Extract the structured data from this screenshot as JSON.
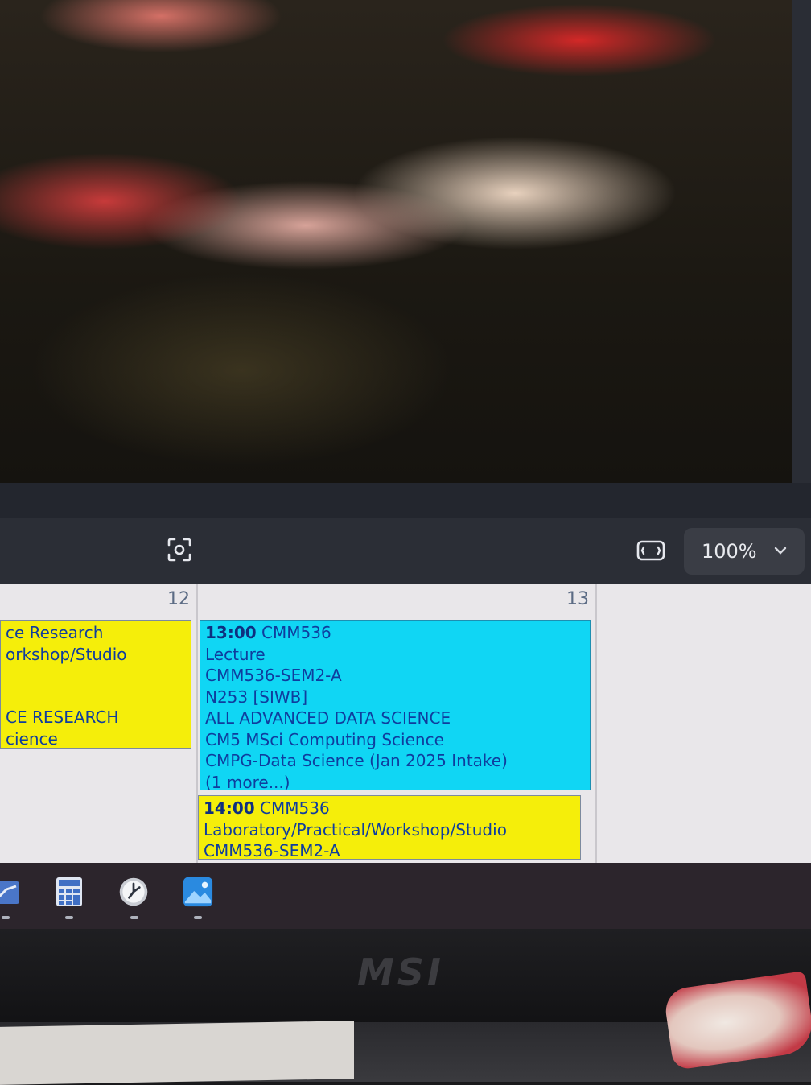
{
  "viewer": {
    "zoom_value": "100%",
    "icons": [
      "focus-frame-icon",
      "aspect-ratio-icon",
      "chevron-down-icon"
    ]
  },
  "calendar": {
    "days": [
      {
        "day": "12",
        "events": [
          {
            "color": "#f5ee0a",
            "lines": [
              "ce Research",
              "orkshop/Studio",
              "",
              "",
              "CE RESEARCH",
              "cience"
            ]
          }
        ]
      },
      {
        "day": "13",
        "events": [
          {
            "color": "#10d6f4",
            "time": "13:00",
            "module": "CMM536",
            "lines": [
              "Lecture",
              "CMM536-SEM2-A",
              "N253 [SIWB]",
              "ALL ADVANCED DATA SCIENCE",
              "CM5 MSci Computing Science",
              "CMPG-Data Science (Jan 2025 Intake)",
              "(1 more...)"
            ]
          },
          {
            "color": "#f5ee0a",
            "time": "14:00",
            "module": "CMM536",
            "lines": [
              "Laboratory/Practical/Workshop/Studio",
              "CMM536-SEM2-A"
            ]
          }
        ]
      }
    ]
  },
  "taskbar": {
    "icons": [
      "mail-icon",
      "calculator-icon",
      "clock-icon",
      "photos-icon"
    ]
  },
  "bezel": {
    "brand": "MSI"
  }
}
